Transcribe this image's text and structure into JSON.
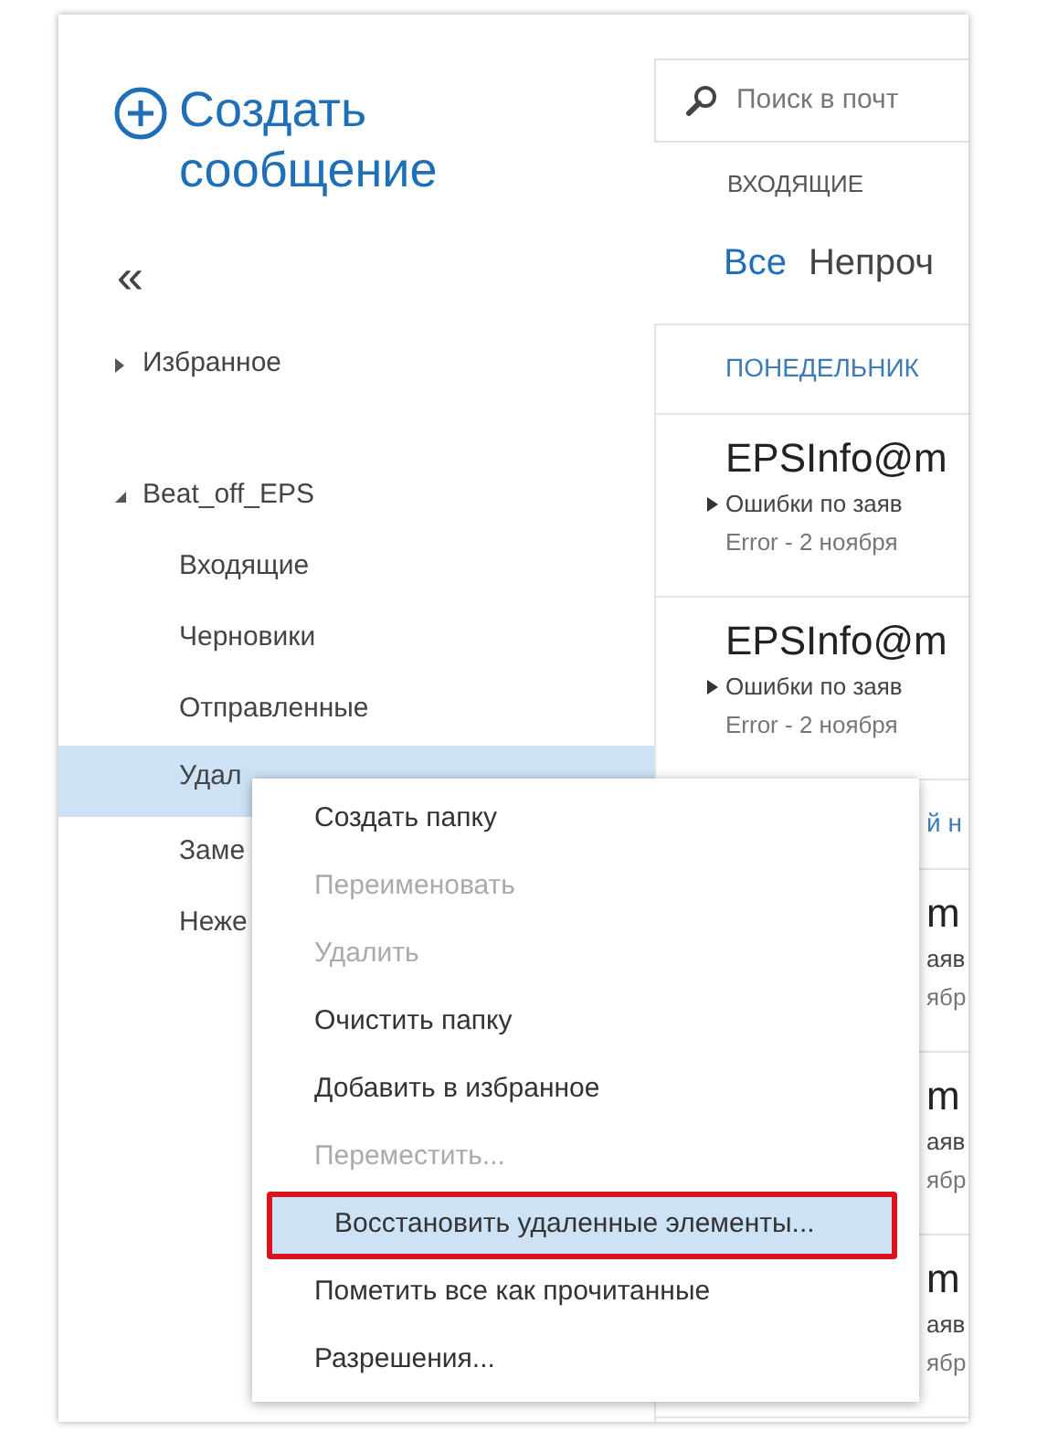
{
  "compose": {
    "label_line1": "Создать",
    "label_line2": "сообщение"
  },
  "collapse": "«",
  "favorites": {
    "label": "Избранное",
    "expanded": false
  },
  "account": {
    "label": "Beat_off_EPS",
    "expanded": true,
    "children": [
      {
        "label": "Входящие",
        "selected": false
      },
      {
        "label": "Черновики",
        "selected": false
      },
      {
        "label": "Отправленные",
        "selected": false
      },
      {
        "label": "Удал",
        "selected": true
      },
      {
        "label": "Заме",
        "selected": false
      },
      {
        "label": "Неже",
        "selected": false
      }
    ]
  },
  "search": {
    "placeholder": "Поиск в почт"
  },
  "folder_title": "ВХОДЯЩИЕ",
  "filters": [
    {
      "label": "Все",
      "selected": true
    },
    {
      "label": "Непроч",
      "selected": false
    }
  ],
  "groups": [
    {
      "header": "ПОНЕДЕЛЬНИК",
      "messages": [
        {
          "sender": "EPSInfo@m",
          "preview": "Ошибки по заяв",
          "date": "Error - 2 ноября",
          "kind": "full"
        },
        {
          "sender": "EPSInfo@m",
          "preview": "Ошибки по заяв",
          "date": "Error - 2 ноября",
          "kind": "full"
        }
      ]
    },
    {
      "header": "й н",
      "messages": [
        {
          "sender": "m",
          "preview": "аяв",
          "date": "ябр",
          "kind": "fragment"
        },
        {
          "sender": "m",
          "preview": "аяв",
          "date": "ябр",
          "kind": "fragment"
        },
        {
          "sender": "m",
          "preview": "аяв",
          "date": "ябр",
          "kind": "fragment"
        }
      ]
    }
  ],
  "context_menu": [
    {
      "label": "Создать папку",
      "disabled": false,
      "selected": false
    },
    {
      "label": "Переименовать",
      "disabled": true,
      "selected": false
    },
    {
      "label": "Удалить",
      "disabled": true,
      "selected": false
    },
    {
      "label": "Очистить папку",
      "disabled": false,
      "selected": false
    },
    {
      "label": "Добавить в избранное",
      "disabled": false,
      "selected": false
    },
    {
      "label": "Переместить...",
      "disabled": true,
      "selected": false
    },
    {
      "label": "Восстановить удаленные элементы...",
      "disabled": false,
      "selected": true
    },
    {
      "label": "Пометить все как прочитанные",
      "disabled": false,
      "selected": false
    },
    {
      "label": "Разрешения...",
      "disabled": false,
      "selected": false
    }
  ]
}
